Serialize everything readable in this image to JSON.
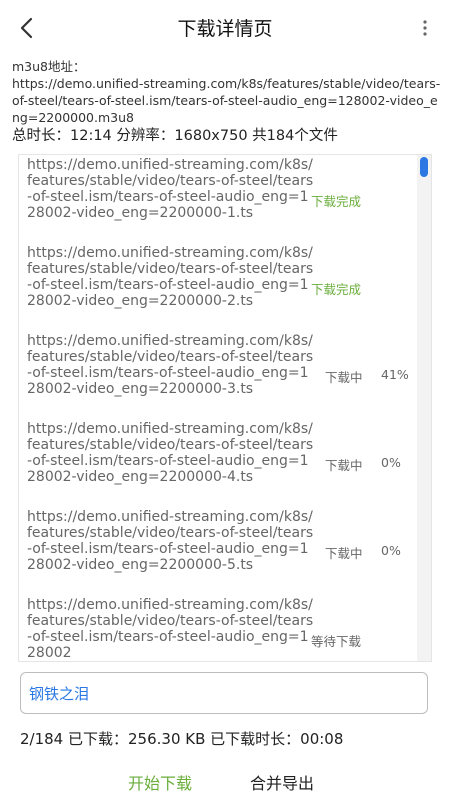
{
  "header": {
    "title": "下载详情页",
    "back_icon": "chevron-left-icon",
    "menu_icon": "more-vert-icon"
  },
  "m3u8": {
    "label": "m3u8地址：",
    "url": "https://demo.unified-streaming.com/k8s/features/stable/video/tears-of-steel/tears-of-steel.ism/tears-of-steel-audio_eng=128002-video_eng=2200000.m3u8"
  },
  "summary": {
    "text": "总时长：12:14 分辨率：1680x750  共184个文件"
  },
  "segments": [
    {
      "url": "https://demo.unified-streaming.com/k8s/features/stable/video/tears-of-steel/tears-of-steel.ism/tears-of-steel-audio_eng=128002-video_eng=2200000-1.ts",
      "status": "下载完成",
      "progress": ""
    },
    {
      "url": "https://demo.unified-streaming.com/k8s/features/stable/video/tears-of-steel/tears-of-steel.ism/tears-of-steel-audio_eng=128002-video_eng=2200000-2.ts",
      "status": "下载完成",
      "progress": ""
    },
    {
      "url": "https://demo.unified-streaming.com/k8s/features/stable/video/tears-of-steel/tears-of-steel.ism/tears-of-steel-audio_eng=128002-video_eng=2200000-3.ts",
      "status": "下载中",
      "progress": "41%"
    },
    {
      "url": "https://demo.unified-streaming.com/k8s/features/stable/video/tears-of-steel/tears-of-steel.ism/tears-of-steel-audio_eng=128002-video_eng=2200000-4.ts",
      "status": "下载中",
      "progress": "0%"
    },
    {
      "url": "https://demo.unified-streaming.com/k8s/features/stable/video/tears-of-steel/tears-of-steel.ism/tears-of-steel-audio_eng=128002-video_eng=2200000-5.ts",
      "status": "下载中",
      "progress": "0%"
    },
    {
      "url": "https://demo.unified-streaming.com/k8s/features/stable/video/tears-of-steel/tears-of-steel.ism/tears-of-steel-audio_eng=128002",
      "status": "等待下载",
      "progress": ""
    }
  ],
  "filename": {
    "value": "钢铁之泪"
  },
  "stats": {
    "text": "2/184  已下载：256.30 KB  已下载时长：00:08"
  },
  "actions": {
    "start_label": "开始下载",
    "merge_label": "合并导出"
  },
  "colors": {
    "accent_green": "#6aae3c",
    "accent_blue": "#2b78e4"
  }
}
